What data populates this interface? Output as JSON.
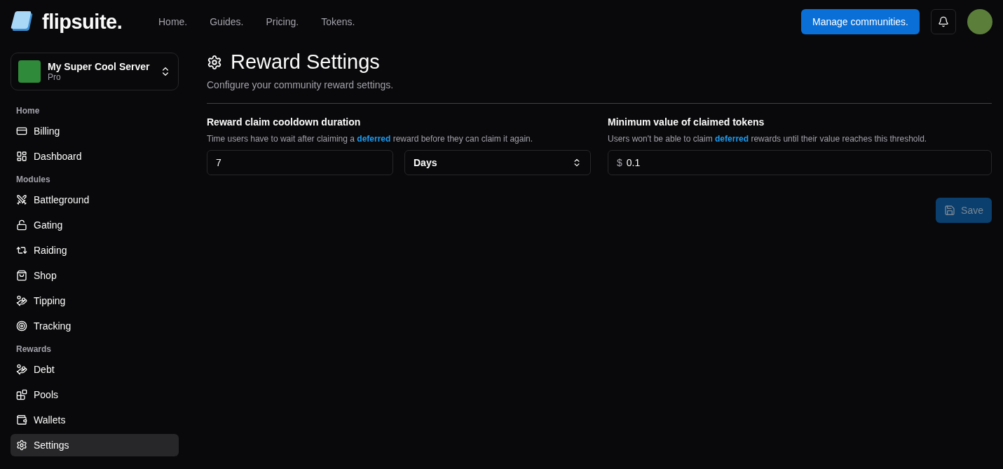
{
  "header": {
    "brand": "flipsuite.",
    "nav": [
      {
        "label": "Home."
      },
      {
        "label": "Guides."
      },
      {
        "label": "Pricing."
      },
      {
        "label": "Tokens."
      }
    ],
    "cta": "Manage communities."
  },
  "server": {
    "name": "My Super Cool Server",
    "plan": "Pro"
  },
  "sidebar": {
    "groups": [
      {
        "title": "Home",
        "items": [
          {
            "label": "Billing",
            "selected": false
          },
          {
            "label": "Dashboard",
            "selected": false
          }
        ]
      },
      {
        "title": "Modules",
        "items": [
          {
            "label": "Battleground",
            "selected": false
          },
          {
            "label": "Gating",
            "selected": false
          },
          {
            "label": "Raiding",
            "selected": false
          },
          {
            "label": "Shop",
            "selected": false
          },
          {
            "label": "Tipping",
            "selected": false
          },
          {
            "label": "Tracking",
            "selected": false
          }
        ]
      },
      {
        "title": "Rewards",
        "items": [
          {
            "label": "Debt",
            "selected": false
          },
          {
            "label": "Pools",
            "selected": false
          },
          {
            "label": "Wallets",
            "selected": false
          },
          {
            "label": "Settings",
            "selected": true
          }
        ]
      }
    ]
  },
  "page": {
    "title": "Reward Settings",
    "subtitle": "Configure your community reward settings."
  },
  "settings": [
    {
      "label": "Reward claim cooldown duration",
      "help": "Time users have to wait after claiming a **deferred** reward before they can claim it again.",
      "fields": [
        {
          "kind": "input",
          "value": "7"
        },
        {
          "kind": "select",
          "value": "Days"
        }
      ]
    },
    {
      "label": "Minimum value of claimed tokens",
      "help": "Users won't be able to claim **deferred** rewards until their value reaches this threshold.",
      "fields": [
        {
          "kind": "prefixed",
          "prefix": "$",
          "value": "0.1"
        }
      ]
    }
  ],
  "save": {
    "label": "Save",
    "disabled": true
  }
}
